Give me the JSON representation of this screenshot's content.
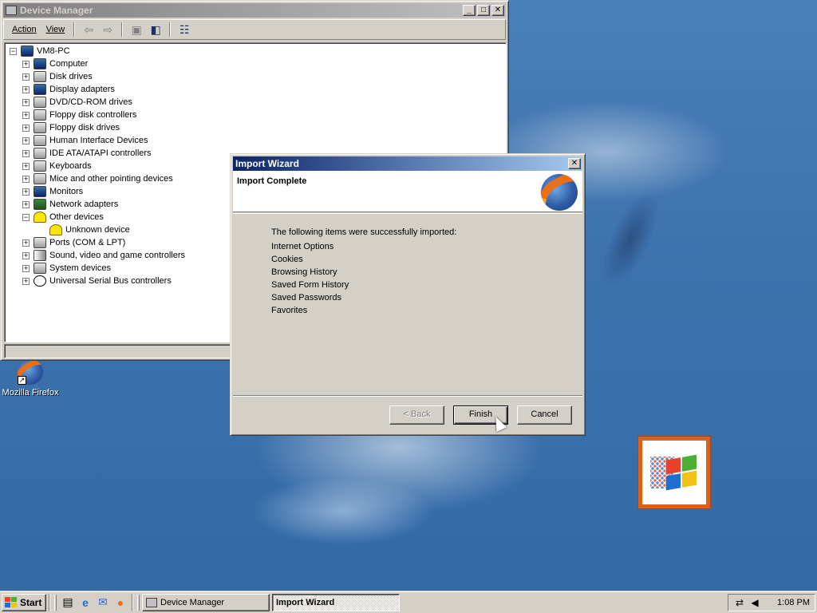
{
  "device_manager": {
    "title": "Device Manager",
    "menu": {
      "action": "Action",
      "view": "View"
    },
    "tree": {
      "root": "VM8-PC",
      "items": [
        {
          "label": "Computer",
          "icon": "computer-icon"
        },
        {
          "label": "Disk drives",
          "icon": "disk-drive-icon"
        },
        {
          "label": "Display adapters",
          "icon": "display-adapter-icon"
        },
        {
          "label": "DVD/CD-ROM drives",
          "icon": "cdrom-icon"
        },
        {
          "label": "Floppy disk controllers",
          "icon": "floppy-controller-icon"
        },
        {
          "label": "Floppy disk drives",
          "icon": "floppy-drive-icon"
        },
        {
          "label": "Human Interface Devices",
          "icon": "hid-icon"
        },
        {
          "label": "IDE ATA/ATAPI controllers",
          "icon": "ide-controller-icon"
        },
        {
          "label": "Keyboards",
          "icon": "keyboard-icon"
        },
        {
          "label": "Mice and other pointing devices",
          "icon": "mouse-icon"
        },
        {
          "label": "Monitors",
          "icon": "monitor-icon"
        },
        {
          "label": "Network adapters",
          "icon": "network-adapter-icon"
        },
        {
          "label": "Other devices",
          "icon": "other-devices-icon",
          "expanded": true,
          "children": [
            {
              "label": "Unknown device",
              "icon": "unknown-device-icon"
            }
          ]
        },
        {
          "label": "Ports (COM & LPT)",
          "icon": "ports-icon"
        },
        {
          "label": "Sound, video and game controllers",
          "icon": "sound-icon"
        },
        {
          "label": "System devices",
          "icon": "system-devices-icon"
        },
        {
          "label": "Universal Serial Bus controllers",
          "icon": "usb-icon"
        }
      ]
    }
  },
  "import_wizard": {
    "title": "Import Wizard",
    "heading": "Import Complete",
    "intro": "The following items were successfully imported:",
    "items": [
      "Internet Options",
      "Cookies",
      "Browsing History",
      "Saved Form History",
      "Saved Passwords",
      "Favorites"
    ],
    "buttons": {
      "back": "< Back",
      "finish": "Finish",
      "cancel": "Cancel"
    }
  },
  "desktop": {
    "icons": [
      {
        "label": "Mozilla Firefox",
        "icon": "firefox-icon"
      }
    ]
  },
  "taskbar": {
    "start": "Start",
    "tasks": [
      {
        "label": "Device Manager",
        "active": false
      },
      {
        "label": "Import Wizard",
        "active": true
      }
    ],
    "clock": "1:08 PM"
  },
  "colors": {
    "active_title": "#0a246a",
    "inactive_title": "#808080",
    "face": "#d4d0c8",
    "desktop": "#3a6ea5",
    "logo_frame": "#d8621d"
  }
}
